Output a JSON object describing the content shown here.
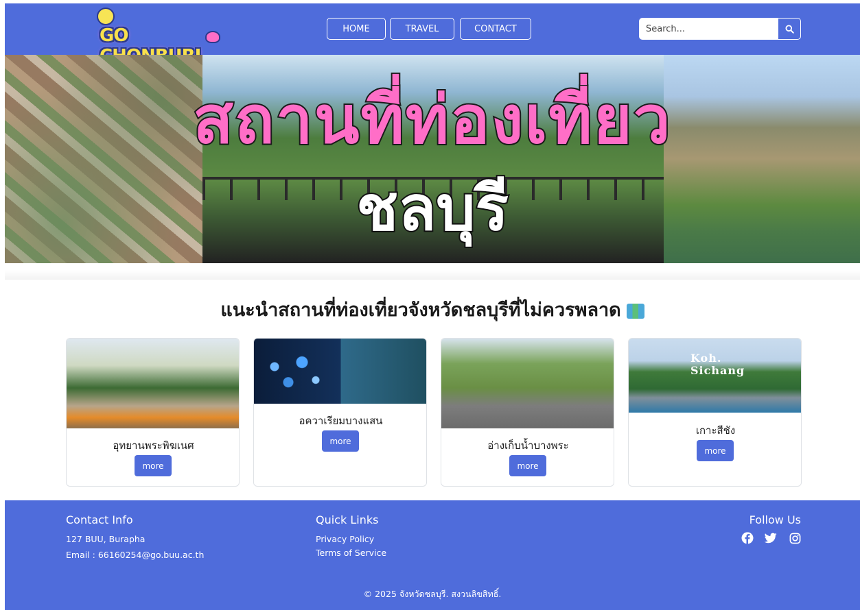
{
  "navbar": {
    "logo_text": "GO CHONBURI",
    "links": [
      "HOME",
      "TRAVEL",
      "CONTACT"
    ],
    "search_placeholder": "Search...",
    "search_icon": "search-icon"
  },
  "hero": {
    "title": "สถานที่ท่องเที่ยว",
    "subtitle": "ชลบุรี"
  },
  "main": {
    "heading": "แนะนำสถานที่ท่องเที่ยวจังหวัดชลบุรีที่ไม่ควรพลาด",
    "heading_icon": "world-map-icon",
    "cards": [
      {
        "title": "อุทยานพระพิฆเนศ",
        "button": "more"
      },
      {
        "title": "อควาเรียมบางแสน",
        "button": "more"
      },
      {
        "title": "อ่างเก็บน้ำบางพระ",
        "button": "more"
      },
      {
        "title": "เกาะสีชัง",
        "button": "more",
        "image_text": [
          "Koh.",
          "Sichang"
        ]
      }
    ]
  },
  "footer": {
    "contact": {
      "heading": "Contact Info",
      "address": "127 BUU, Burapha",
      "email": "Email : 66160254@go.buu.ac.th"
    },
    "quick_links": {
      "heading": "Quick Links",
      "links": [
        "Privacy Policy",
        "Terms of Service"
      ]
    },
    "follow": {
      "heading": "Follow Us",
      "icons": [
        "facebook-icon",
        "twitter-icon",
        "instagram-icon"
      ]
    },
    "copyright": "© 2025 จังหวัดชลบุรี. สงวนลิขสิทธิ์."
  },
  "colors": {
    "brand": "#4f6cdb",
    "white": "#ffffff"
  }
}
